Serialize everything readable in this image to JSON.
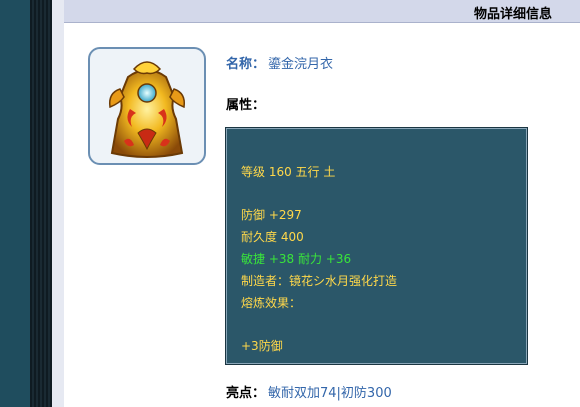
{
  "header": {
    "title": "物品详细信息"
  },
  "item": {
    "icon": "golden-armor-robe-icon",
    "name_label": "名称：",
    "name": "鎏金浣月衣",
    "attributes_label": "属性："
  },
  "stats": {
    "level_line": "等级 160 五行 土",
    "defense": "防御 +297",
    "durability": "耐久度 400",
    "bonus": "敏捷 +38 耐力 +36",
    "maker": "制造者：镜花シ水月强化打造",
    "smelting_label": "熔炼效果：",
    "smelting_value": "+3防御"
  },
  "highlight": {
    "label": "亮点：",
    "value": "敏耐双加74|初防300"
  },
  "colors": {
    "stat_box_bg": "#2b5769",
    "yellow_text": "#ffd84a",
    "green_text": "#39e53a",
    "link_blue": "#3366aa"
  }
}
